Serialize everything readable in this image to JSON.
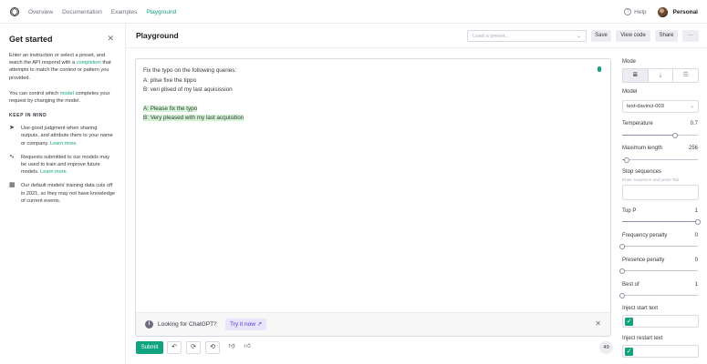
{
  "nav": {
    "links": [
      "Overview",
      "Documentation",
      "Examples",
      "Playground"
    ],
    "help": "Help",
    "account": "Personal"
  },
  "left": {
    "title": "Get started",
    "intro_pre": "Enter an instruction or select a preset, and watch the API respond with a ",
    "intro_link": "completion",
    "intro_post": " that attempts to match the context or pattern you provided.",
    "control_pre": "You can control which ",
    "control_link": "model",
    "control_post": " completes your request by changing the model.",
    "keep_heading": "KEEP IN MIND",
    "items": [
      {
        "text": "Use good judgment when sharing outputs, and attribute them to your name or company. ",
        "link": "Learn more."
      },
      {
        "text": "Requests submitted to our models may be used to train and improve future models. ",
        "link": "Learn more."
      },
      {
        "text": "Our default models' training data cuts off in 2021, so they may not have knowledge of current events.",
        "link": ""
      }
    ]
  },
  "header": {
    "title": "Playground",
    "preset_placeholder": "Load a preset...",
    "save": "Save",
    "view_code": "View code",
    "share": "Share",
    "more": "···"
  },
  "editor": {
    "prompt_lines": [
      "Fix the typo on the following queries:",
      "A: plise fixe the tippo",
      "B: veri plised of my last aquisission"
    ],
    "completion_lines": [
      "A: Please fix the typo",
      "B: Very pleased with my last acquisition"
    ]
  },
  "banner": {
    "text": "Looking for ChatGPT?",
    "cta": "Try it now"
  },
  "toolbar": {
    "submit": "Submit",
    "token_count": "49"
  },
  "settings": {
    "mode_label": "Mode",
    "model_label": "Model",
    "model_value": "text-davinci-003",
    "temperature_label": "Temperature",
    "temperature_value": "0.7",
    "temperature_fraction": 0.7,
    "max_length_label": "Maximum length",
    "max_length_value": "256",
    "max_length_fraction": 0.06,
    "stop_label": "Stop sequences",
    "stop_hint": "Enter sequence and press Tab",
    "top_p_label": "Top P",
    "top_p_value": "1",
    "top_p_fraction": 1.0,
    "freq_label": "Frequency penalty",
    "freq_value": "0",
    "freq_fraction": 0,
    "presence_label": "Presence penalty",
    "presence_value": "0",
    "presence_fraction": 0,
    "best_of_label": "Best of",
    "best_of_value": "1",
    "best_of_fraction": 0,
    "inject_start_label": "Inject start text",
    "inject_start_checked": true,
    "inject_restart_label": "Inject restart text",
    "inject_restart_checked": true
  }
}
